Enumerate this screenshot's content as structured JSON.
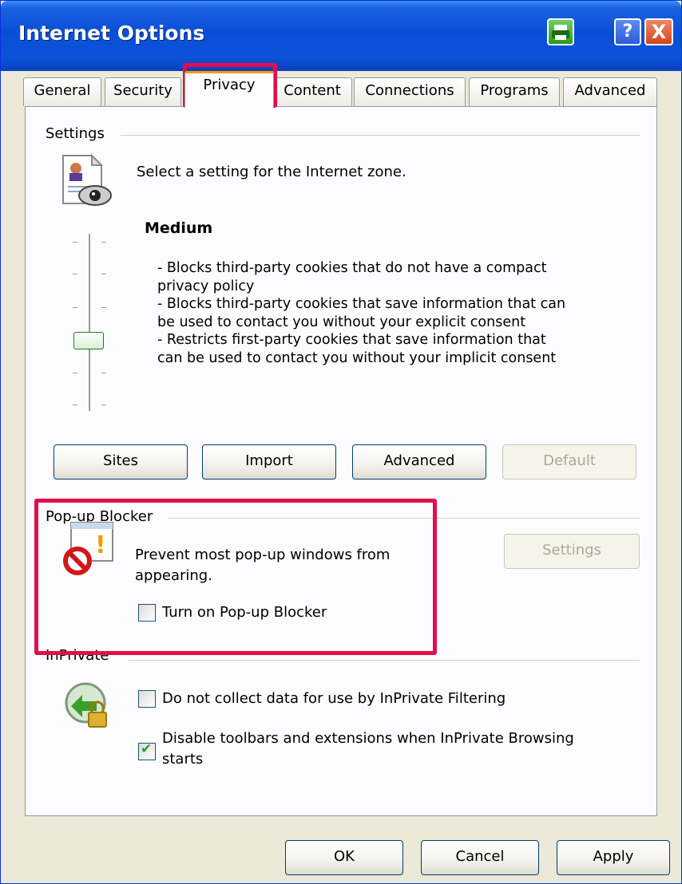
{
  "window": {
    "title": "Internet Options"
  },
  "title_buttons": {
    "help": "?",
    "close": "X"
  },
  "tabs": [
    {
      "label": "General"
    },
    {
      "label": "Security"
    },
    {
      "label": "Privacy",
      "active": true
    },
    {
      "label": "Content"
    },
    {
      "label": "Connections"
    },
    {
      "label": "Programs"
    },
    {
      "label": "Advanced"
    }
  ],
  "settings": {
    "group_label": "Settings",
    "prompt": "Select a setting for the Internet zone.",
    "level": "Medium",
    "description": [
      "- Blocks third-party cookies that do not have a compact",
      "privacy policy",
      "- Blocks third-party cookies that save information that can",
      "be used to contact you without your explicit consent",
      "- Restricts first-party cookies that save information that",
      "can be used to contact you without your implicit consent"
    ],
    "buttons": {
      "sites": "Sites",
      "import": "Import",
      "advanced": "Advanced",
      "default": "Default"
    }
  },
  "popup_blocker": {
    "group_label": "Pop-up Blocker",
    "description_line1": "Prevent most pop-up windows from",
    "description_line2": "appearing.",
    "settings_button": "Settings",
    "checkbox_label": "Turn on Pop-up Blocker",
    "checked": false
  },
  "inprivate": {
    "group_label": "InPrivate",
    "filtering_label": "Do not collect data for use by InPrivate Filtering",
    "filtering_checked": false,
    "toolbars_label_line1": "Disable toolbars and extensions when InPrivate Browsing",
    "toolbars_label_line2": "starts",
    "toolbars_checked": true
  },
  "footer": {
    "ok": "OK",
    "cancel": "Cancel",
    "apply": "Apply"
  },
  "colors": {
    "highlight": "#e0104a",
    "titlebar": "#0a4ed8",
    "active_tab_top": "#ff9c00"
  }
}
